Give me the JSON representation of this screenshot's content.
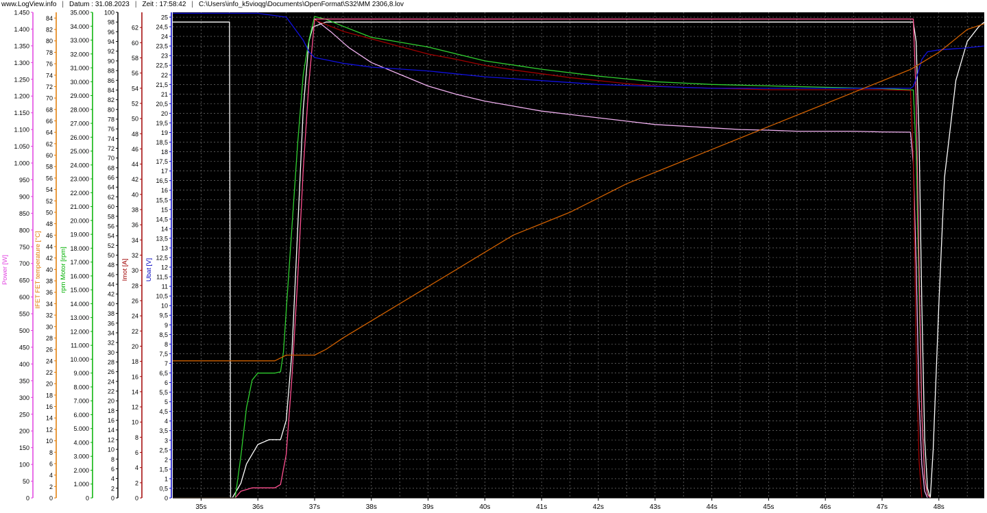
{
  "header": {
    "site": "www.LogView.info",
    "date": "Datum : 31.08.2023",
    "time": "Zeit : 17:58:42",
    "path": "C:\\Users\\info_k5vioqg\\Documents\\OpenFormat\\S32\\MM 2306,8.lov"
  },
  "chart_data": {
    "type": "line",
    "x_tick_labels": [
      "35s",
      "36s",
      "37s",
      "38s",
      "39s",
      "40s",
      "41s",
      "42s",
      "43s",
      "44s",
      "45s",
      "46s",
      "47s",
      "48s"
    ],
    "xlim": [
      34.5,
      48.8
    ],
    "grid": true,
    "axes": [
      {
        "id": "power",
        "label": "Power [W]",
        "color": "#e040e0",
        "ylim": [
          0,
          1450
        ],
        "ticks": [
          0,
          50,
          100,
          150,
          200,
          250,
          300,
          350,
          400,
          450,
          500,
          550,
          600,
          650,
          700,
          750,
          800,
          850,
          900,
          950,
          1000,
          1050,
          1100,
          1150,
          1200,
          1250,
          1300,
          1350,
          1400,
          1450
        ],
        "tick_labels": [
          "0",
          "50",
          "100",
          "150",
          "200",
          "250",
          "300",
          "350",
          "400",
          "450",
          "500",
          "550",
          "600",
          "650",
          "700",
          "750",
          "800",
          "850",
          "900",
          "950",
          "1.000",
          "1.050",
          "1.100",
          "1.150",
          "1.200",
          "1.250",
          "1.300",
          "1.350",
          "1.400",
          "1.450"
        ]
      },
      {
        "id": "temp",
        "label": "IFET  FET temperature [°C]",
        "color": "#e07800",
        "ylim": [
          0,
          85
        ],
        "ticks": [
          0,
          2,
          4,
          6,
          8,
          10,
          12,
          14,
          16,
          18,
          20,
          22,
          24,
          26,
          28,
          30,
          32,
          34,
          36,
          38,
          40,
          42,
          44,
          46,
          48,
          50,
          52,
          54,
          56,
          58,
          60,
          62,
          64,
          66,
          68,
          70,
          72,
          74,
          76,
          78,
          80,
          82,
          84
        ],
        "tick_labels": [
          "0",
          "2",
          "4",
          "6",
          "8",
          "10",
          "12",
          "14",
          "16",
          "18",
          "20",
          "22",
          "24",
          "26",
          "28",
          "30",
          "32",
          "34",
          "36",
          "38",
          "40",
          "42",
          "44",
          "46",
          "48",
          "50",
          "52",
          "54",
          "56",
          "58",
          "60",
          "62",
          "64",
          "66",
          "68",
          "70",
          "72",
          "74",
          "76",
          "78",
          "80",
          "82",
          "84"
        ]
      },
      {
        "id": "rpm",
        "label": "rpm Motor [rpm]",
        "color": "#00b000",
        "ylim": [
          0,
          35000
        ],
        "ticks": [
          0,
          1000,
          2000,
          3000,
          4000,
          5000,
          6000,
          7000,
          8000,
          9000,
          10000,
          11000,
          12000,
          13000,
          14000,
          15000,
          16000,
          17000,
          18000,
          19000,
          20000,
          21000,
          22000,
          23000,
          24000,
          25000,
          26000,
          27000,
          28000,
          29000,
          30000,
          31000,
          32000,
          33000,
          34000,
          35000
        ],
        "tick_labels": [
          "0",
          "1.000",
          "2.000",
          "3.000",
          "4.000",
          "5.000",
          "6.000",
          "7.000",
          "8.000",
          "9.000",
          "10.000",
          "11.000",
          "12.000",
          "13.000",
          "14.000",
          "15.000",
          "16.000",
          "17.000",
          "18.000",
          "19.000",
          "20.000",
          "21.000",
          "22.000",
          "23.000",
          "24.000",
          "25.000",
          "26.000",
          "27.000",
          "28.000",
          "29.000",
          "30.000",
          "31.000",
          "32.000",
          "33.000",
          "34.000",
          "35.000"
        ]
      },
      {
        "id": "throttle",
        "label": "",
        "color": "#000000",
        "ylim": [
          0,
          100
        ],
        "ticks": [
          0,
          2,
          4,
          6,
          8,
          10,
          12,
          14,
          16,
          18,
          20,
          22,
          24,
          26,
          28,
          30,
          32,
          34,
          36,
          38,
          40,
          42,
          44,
          46,
          48,
          50,
          52,
          54,
          56,
          58,
          60,
          62,
          64,
          66,
          68,
          70,
          72,
          74,
          76,
          78,
          80,
          82,
          84,
          86,
          88,
          90,
          92,
          94,
          96,
          98,
          100
        ],
        "tick_labels": [
          "0",
          "2",
          "4",
          "6",
          "8",
          "10",
          "12",
          "14",
          "16",
          "18",
          "20",
          "22",
          "24",
          "26",
          "28",
          "30",
          "32",
          "34",
          "36",
          "38",
          "40",
          "42",
          "44",
          "46",
          "48",
          "50",
          "52",
          "54",
          "56",
          "58",
          "60",
          "62",
          "64",
          "66",
          "68",
          "70",
          "72",
          "74",
          "76",
          "78",
          "80",
          "82",
          "84",
          "86",
          "88",
          "90",
          "92",
          "94",
          "96",
          "98",
          "100"
        ]
      },
      {
        "id": "imot",
        "label": "Imot [A]",
        "color": "#a00000",
        "ylim": [
          0,
          64
        ],
        "ticks": [
          0,
          2,
          4,
          6,
          8,
          10,
          12,
          14,
          16,
          18,
          20,
          22,
          24,
          26,
          28,
          30,
          32,
          34,
          36,
          38,
          40,
          42,
          44,
          46,
          48,
          50,
          52,
          54,
          56,
          58,
          60,
          62
        ],
        "tick_labels": [
          "0",
          "2",
          "4",
          "6",
          "8",
          "10",
          "12",
          "14",
          "16",
          "18",
          "20",
          "22",
          "24",
          "26",
          "28",
          "30",
          "32",
          "34",
          "36",
          "38",
          "40",
          "42",
          "44",
          "46",
          "48",
          "50",
          "52",
          "54",
          "56",
          "58",
          "60",
          "62"
        ]
      },
      {
        "id": "ubat",
        "label": "Ubat [V]",
        "color": "#0000c0",
        "ylim": [
          0,
          25.25
        ],
        "ticks": [
          0,
          0.5,
          1,
          1.5,
          2,
          2.5,
          3,
          3.5,
          4,
          4.5,
          5,
          5.5,
          6,
          6.5,
          7,
          7.5,
          8,
          8.5,
          9,
          9.5,
          10,
          10.5,
          11,
          11.5,
          12,
          12.5,
          13,
          13.5,
          14,
          14.5,
          15,
          15.5,
          16,
          16.5,
          17,
          17.5,
          18,
          18.5,
          19,
          19.5,
          20,
          20.5,
          21,
          21.5,
          22,
          22.5,
          23,
          23.5,
          24,
          24.5,
          25
        ],
        "tick_labels": [
          "0",
          "0,5",
          "1",
          "1,5",
          "2",
          "2,5",
          "3",
          "3,5",
          "4",
          "4,5",
          "5",
          "5,5",
          "6",
          "6,5",
          "7",
          "7,5",
          "8",
          "8,5",
          "9",
          "9,5",
          "10",
          "10,5",
          "11",
          "11,5",
          "12",
          "12,5",
          "13",
          "13,5",
          "14",
          "14,5",
          "15",
          "15,5",
          "16",
          "16,5",
          "17",
          "17,5",
          "18",
          "18,5",
          "19",
          "19,5",
          "20",
          "20,5",
          "21",
          "21,5",
          "22",
          "22,5",
          "23",
          "23,5",
          "24",
          "24,5",
          "25"
        ]
      }
    ],
    "series": [
      {
        "axis": "throttle",
        "color": "#ffffff",
        "x": [
          34.5,
          35.5,
          35.52,
          35.55,
          35.7,
          35.8,
          35.9,
          36.0,
          36.2,
          36.4,
          36.5,
          36.6,
          36.7,
          36.8,
          36.9,
          36.97,
          37.2,
          47.55,
          47.6,
          47.65,
          47.7,
          47.75,
          47.8,
          47.85,
          47.9,
          48.0,
          48.1,
          48.3,
          48.5,
          48.7,
          48.8
        ],
        "y": [
          98,
          98,
          0,
          0,
          3,
          7,
          9,
          11,
          12,
          12,
          16,
          30,
          55,
          80,
          94,
          97,
          98,
          98,
          94,
          75,
          40,
          12,
          2,
          0,
          10,
          40,
          66,
          86,
          94,
          97,
          98
        ]
      },
      {
        "axis": "rpm",
        "color": "#30d030",
        "x": [
          34.5,
          35.6,
          35.7,
          35.8,
          35.9,
          36.0,
          36.1,
          36.2,
          36.3,
          36.4,
          36.45,
          36.5,
          36.6,
          36.7,
          36.8,
          36.9,
          37.0,
          37.2,
          37.5,
          38.0,
          39.0,
          40.0,
          41.0,
          42.0,
          43.0,
          44.0,
          45.0,
          46.0,
          47.0,
          47.55,
          47.6,
          47.65,
          47.7,
          47.75,
          47.8,
          47.85
        ],
        "y": [
          0,
          0,
          3000,
          6500,
          8500,
          9000,
          9000,
          9000,
          9000,
          9100,
          10500,
          13500,
          19500,
          25500,
          30500,
          33000,
          34700,
          34500,
          34000,
          33200,
          32500,
          31500,
          30900,
          30400,
          30000,
          29800,
          29700,
          29600,
          29500,
          29400,
          25000,
          15000,
          6000,
          1500,
          300,
          0
        ]
      },
      {
        "axis": "power",
        "color": "#ff5090",
        "x": [
          34.5,
          35.6,
          35.7,
          35.8,
          35.9,
          36.0,
          36.1,
          36.2,
          36.3,
          36.4,
          36.5,
          36.6,
          36.7,
          36.8,
          36.9,
          37.0,
          47.55,
          47.6,
          47.65,
          47.7,
          47.75,
          47.8,
          47.85
        ],
        "y": [
          0,
          0,
          20,
          25,
          30,
          30,
          30,
          30,
          30,
          40,
          130,
          360,
          650,
          980,
          1240,
          1430,
          1430,
          1200,
          700,
          250,
          60,
          10,
          0
        ]
      },
      {
        "axis": "power",
        "color": "#f0b0f0",
        "x": [
          37.0,
          37.3,
          37.6,
          38.0,
          38.5,
          39.0,
          39.5,
          40.0,
          40.5,
          41.0,
          41.5,
          42.0,
          42.5,
          43.0,
          43.5,
          44.0,
          44.5,
          45.0,
          45.5,
          46.0,
          46.5,
          47.0,
          47.5,
          47.55,
          47.6,
          47.65,
          47.7,
          47.75,
          47.8
        ],
        "y": [
          1430,
          1390,
          1345,
          1300,
          1265,
          1230,
          1205,
          1185,
          1170,
          1155,
          1145,
          1135,
          1125,
          1115,
          1110,
          1105,
          1100,
          1098,
          1095,
          1095,
          1095,
          1093,
          1092,
          1000,
          700,
          300,
          100,
          20,
          0
        ]
      },
      {
        "axis": "imot",
        "color": "#a00000",
        "x": [
          37.0,
          37.5,
          38.0,
          38.5,
          39.0,
          39.5,
          40.0,
          40.5,
          41.0,
          41.5,
          42.0,
          42.5,
          43.0,
          43.5,
          44.0,
          44.5,
          45.0,
          45.5,
          46.0,
          46.5,
          47.0,
          47.5,
          47.55,
          47.6,
          47.65,
          47.7
        ],
        "y": [
          63,
          61.5,
          60.5,
          59.5,
          58.5,
          57.8,
          57,
          56.4,
          55.9,
          55.4,
          55,
          54.6,
          54.3,
          54.1,
          54,
          53.9,
          53.8,
          53.8,
          53.8,
          53.8,
          53.8,
          53.7,
          45,
          20,
          5,
          0
        ]
      },
      {
        "axis": "ubat",
        "color": "#1010e0",
        "x": [
          34.5,
          35.5,
          36.0,
          36.5,
          36.6,
          36.8,
          36.9,
          37.0,
          37.5,
          38.0,
          39.0,
          40.0,
          41.0,
          42.0,
          43.0,
          44.0,
          45.0,
          46.0,
          47.0,
          47.5,
          47.55,
          47.6,
          47.65,
          47.7,
          47.8,
          48.0,
          48.5,
          48.8
        ],
        "y": [
          25.2,
          25.2,
          25.2,
          25,
          24.6,
          23.8,
          23.2,
          22.9,
          22.6,
          22.4,
          22.2,
          21.9,
          21.7,
          21.5,
          21.4,
          21.3,
          21.3,
          21.3,
          21.3,
          21.3,
          21.4,
          21.8,
          22.3,
          22.8,
          23.2,
          23.3,
          23.4,
          23.5
        ]
      },
      {
        "axis": "temp",
        "color": "#d06000",
        "x": [
          34.5,
          36.3,
          36.5,
          37.0,
          37.2,
          37.5,
          38.0,
          38.5,
          39.0,
          39.5,
          40.0,
          40.5,
          41.0,
          41.5,
          42.0,
          42.5,
          43.0,
          43.5,
          44.0,
          44.5,
          45.0,
          45.5,
          46.0,
          46.5,
          47.0,
          47.5,
          48.0,
          48.5,
          48.8
        ],
        "y": [
          24,
          24,
          25,
          25,
          26,
          28,
          31,
          34,
          37,
          40,
          43,
          46,
          48,
          50,
          52.5,
          55,
          57,
          59,
          61,
          63,
          65,
          67,
          69,
          71,
          73,
          75,
          78,
          82,
          83
        ]
      }
    ]
  }
}
